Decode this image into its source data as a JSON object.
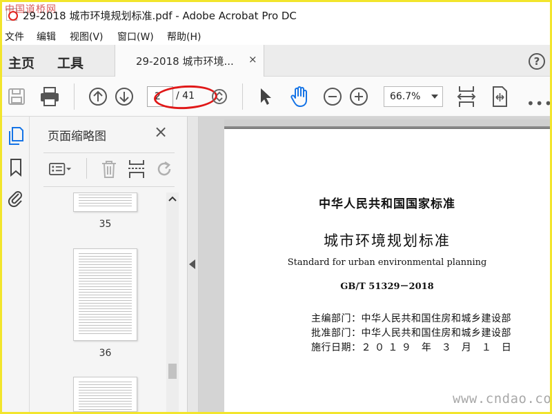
{
  "window": {
    "title": "29-2018 城市环境规划标准.pdf - Adobe Acrobat Pro DC",
    "watermark_logo": "中国道桥网"
  },
  "menu": {
    "items": [
      "文件",
      "编辑",
      "视图(V)",
      "窗口(W)",
      "帮助(H)"
    ]
  },
  "tabs": {
    "home": "主页",
    "tools": "工具",
    "document": "29-2018 城市环境...",
    "close_glyph": "×",
    "help_glyph": "?"
  },
  "toolbar": {
    "page_current": "2",
    "page_total": "/ 41",
    "zoom": "66.7%",
    "more": "•••"
  },
  "panel": {
    "title": "页面缩略图",
    "close_glyph": "×",
    "thumbnails": [
      {
        "label": "35"
      },
      {
        "label": "36"
      },
      {
        "label": ""
      }
    ]
  },
  "document": {
    "header": "中华人民共和国国家标准",
    "title_cn": "城市环境规划标准",
    "title_en": "Standard for urban environmental planning",
    "standard_no": "GB/T 51329－2018",
    "meta": [
      "主编部门：中华人民共和国住房和城乡建设部",
      "批准部门：中华人民共和国住房和城乡建设部",
      "施行日期：２ ０ １ ９　年　３　月　１　日"
    ]
  },
  "watermark": {
    "site": "www.cndao.com"
  },
  "colors": {
    "frame": "#f2e52c",
    "annotation": "#e01818",
    "accent_blue": "#1473e6"
  }
}
